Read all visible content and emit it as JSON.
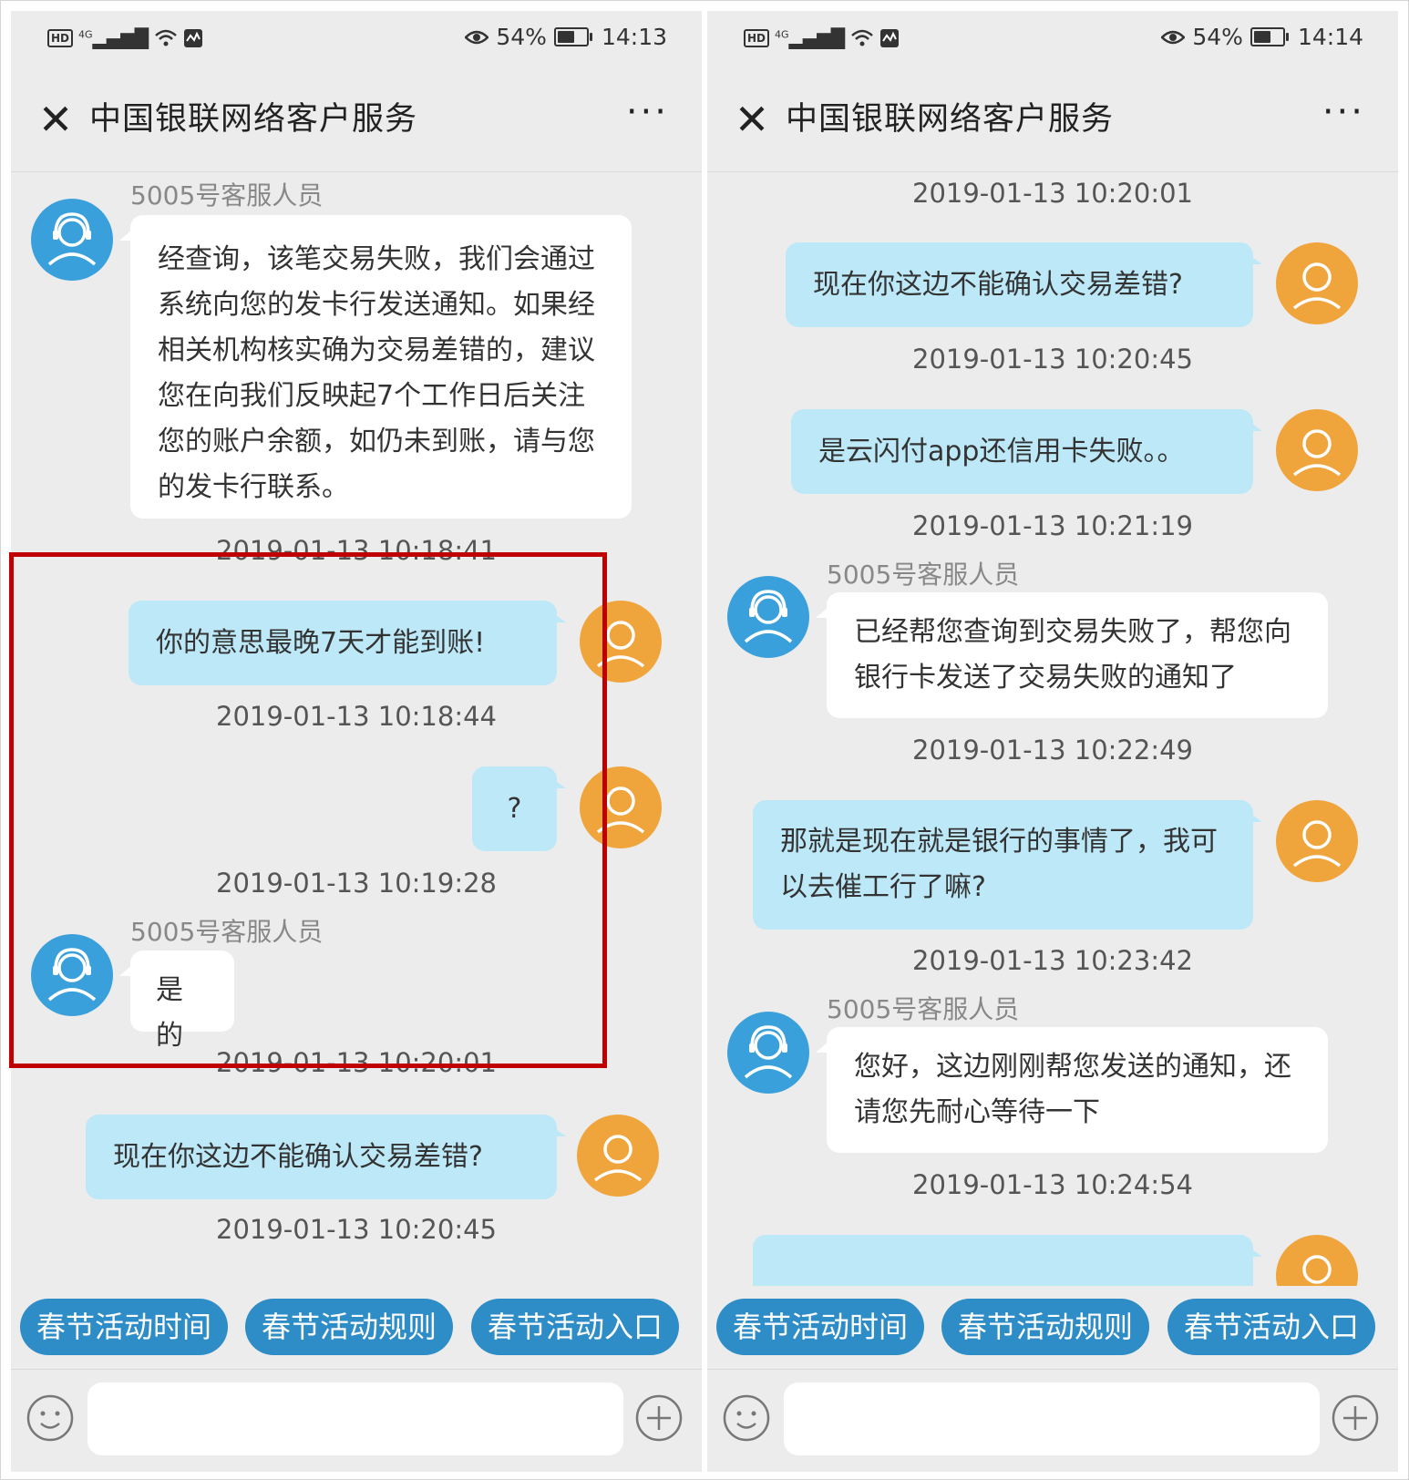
{
  "colors": {
    "user_bubble": "#bde8f7",
    "agent_bubble": "#ffffff",
    "agent_avatar": "#3aa0dc",
    "user_avatar": "#f0a43c",
    "quick_button": "#2e8cc6",
    "highlight": "#c00000"
  },
  "left": {
    "status": {
      "battery": "54%",
      "time": "14:13",
      "network": "4G"
    },
    "title": "中国银联网络客户服务",
    "messages": [
      {
        "kind": "agent-name",
        "text": "5005号客服人员"
      },
      {
        "kind": "agent",
        "text": "经查询，该笔交易失败，我们会通过系统向您的发卡行发送通知。如果经相关机构核实确为交易差错的，建议您在向我们反映起7个工作日后关注您的账户余额，如仍未到账，请与您的发卡行联系。"
      },
      {
        "kind": "ts",
        "text": "2019-01-13 10:18:41"
      },
      {
        "kind": "user",
        "text": "你的意思最晚7天才能到账!"
      },
      {
        "kind": "ts",
        "text": "2019-01-13 10:18:44"
      },
      {
        "kind": "user",
        "text": "?"
      },
      {
        "kind": "ts",
        "text": "2019-01-13 10:19:28"
      },
      {
        "kind": "agent-name",
        "text": "5005号客服人员"
      },
      {
        "kind": "agent",
        "text": "是的"
      },
      {
        "kind": "ts",
        "text": "2019-01-13 10:20:01"
      },
      {
        "kind": "user",
        "text": "现在你这边不能确认交易差错?"
      },
      {
        "kind": "ts",
        "text": "2019-01-13 10:20:45"
      }
    ],
    "quick_replies": [
      "春节活动时间",
      "春节活动规则",
      "春节活动入口"
    ]
  },
  "right": {
    "status": {
      "battery": "54%",
      "time": "14:14",
      "network": "4G"
    },
    "title": "中国银联网络客户服务",
    "messages": [
      {
        "kind": "ts",
        "text": "2019-01-13 10:20:01"
      },
      {
        "kind": "user",
        "text": "现在你这边不能确认交易差错?"
      },
      {
        "kind": "ts",
        "text": "2019-01-13 10:20:45"
      },
      {
        "kind": "user",
        "text": "是云闪付app还信用卡失败。。"
      },
      {
        "kind": "ts",
        "text": "2019-01-13 10:21:19"
      },
      {
        "kind": "agent-name",
        "text": "5005号客服人员"
      },
      {
        "kind": "agent",
        "text": "已经帮您查询到交易失败了，帮您向银行卡发送了交易失败的通知了"
      },
      {
        "kind": "ts",
        "text": "2019-01-13 10:22:49"
      },
      {
        "kind": "user",
        "text": "那就是现在就是银行的事情了，我可以去催工行了嘛?"
      },
      {
        "kind": "ts",
        "text": "2019-01-13 10:23:42"
      },
      {
        "kind": "agent-name",
        "text": "5005号客服人员"
      },
      {
        "kind": "agent",
        "text": "您好，这边刚刚帮您发送的通知，还请您先耐心等待一下"
      },
      {
        "kind": "ts",
        "text": "2019-01-13 10:24:54"
      },
      {
        "kind": "user",
        "text": ""
      }
    ],
    "quick_replies": [
      "春节活动时间",
      "春节活动规则",
      "春节活动入口"
    ]
  }
}
